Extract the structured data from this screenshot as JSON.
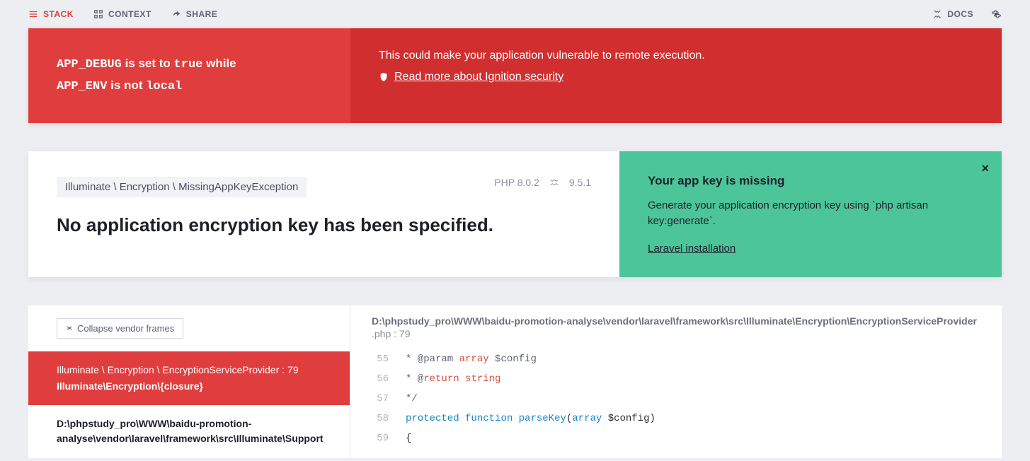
{
  "nav": {
    "stack": "STACK",
    "context": "CONTEXT",
    "share": "SHARE",
    "docs": "DOCS"
  },
  "warning": {
    "left_html_parts": {
      "p1a": "APP_DEBUG",
      "p1b": "is set to",
      "p1c": "true",
      "p1d": "while",
      "p2a": "APP_ENV",
      "p2b": "is not",
      "p2c": "local"
    },
    "right_text": "This could make your application vulnerable to remote execution.",
    "right_link": "Read more about Ignition security"
  },
  "error": {
    "exception": "Illuminate \\ Encryption \\ MissingAppKeyException",
    "php_version": "PHP 8.0.2",
    "laravel_version": "9.5.1",
    "title": "No application encryption key has been specified."
  },
  "solution": {
    "title": "Your app key is missing",
    "description": "Generate your application encryption key using `php artisan key:generate`.",
    "link": "Laravel installation"
  },
  "stack": {
    "collapse_label": "Collapse vendor frames",
    "frames": [
      {
        "namespace": "Illuminate \\ Encryption \\ EncryptionServiceProvider : 79",
        "function": "Illuminate\\Encryption\\{closure}"
      },
      {
        "path": "D:\\phpstudy_pro\\WWW\\baidu-promotion-analyse\\vendor\\laravel\\framework\\src\\Illuminate\\Support"
      }
    ]
  },
  "code": {
    "path": "D:\\phpstudy_pro\\WWW\\baidu-promotion-analyse\\vendor\\laravel\\framework\\src\\Illuminate\\Encryption\\EncryptionServiceProvider",
    "subpath": ".php : 79",
    "lines": [
      {
        "n": "55",
        "tokens": [
          {
            "t": " * @param  ",
            "c": "comment"
          },
          {
            "t": "array",
            "c": "arr"
          },
          {
            "t": "  $config",
            "c": "comment"
          }
        ]
      },
      {
        "n": "56",
        "tokens": [
          {
            "t": " * @",
            "c": "comment"
          },
          {
            "t": "return",
            "c": "ret"
          },
          {
            "t": " string",
            "c": "ret"
          }
        ]
      },
      {
        "n": "57",
        "tokens": [
          {
            "t": " */",
            "c": "comment"
          }
        ]
      },
      {
        "n": "58",
        "tokens": [
          {
            "t": "protected",
            "c": "kw"
          },
          {
            "t": " ",
            "c": ""
          },
          {
            "t": "function",
            "c": "kw"
          },
          {
            "t": " ",
            "c": ""
          },
          {
            "t": "parseKey",
            "c": "fn"
          },
          {
            "t": "(",
            "c": ""
          },
          {
            "t": "array",
            "c": "type"
          },
          {
            "t": " $config)",
            "c": ""
          }
        ]
      },
      {
        "n": "59",
        "tokens": [
          {
            "t": "{",
            "c": ""
          }
        ]
      }
    ]
  }
}
